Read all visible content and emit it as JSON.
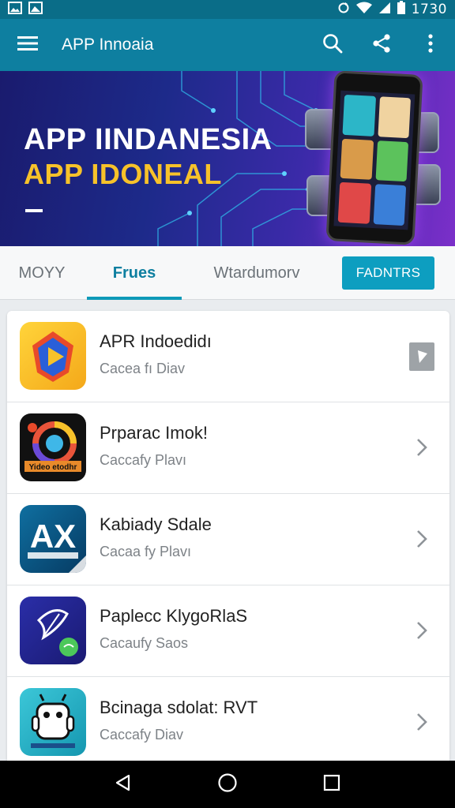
{
  "status_bar": {
    "time": "1730",
    "icons": [
      "image-icon",
      "gallery-icon",
      "sync-icon",
      "wifi-icon",
      "signal-icon",
      "battery-icon"
    ]
  },
  "app_bar": {
    "title": "APP Innoaia",
    "icons": [
      "menu-icon",
      "search-icon",
      "share-icon",
      "more-vert-icon"
    ],
    "background": "#0e7fa0"
  },
  "banner": {
    "title_line1": "APP IINDANESIA",
    "title_line2": "APP IDONEAL",
    "title_line1_color": "#ffffff",
    "title_line2_color": "#f7c22a"
  },
  "tabs": {
    "items": [
      {
        "label": "MOYY",
        "active": false
      },
      {
        "label": "Frues",
        "active": true
      },
      {
        "label": "Wtardumorv",
        "active": false
      }
    ],
    "button_label": "FADNTRS",
    "accent": "#0e9ab8"
  },
  "apps": [
    {
      "name": "APR Indoedidı",
      "subtitle": "Cacea fı Diav",
      "icon": "play-logo-icon",
      "trailing": "play-badge-icon"
    },
    {
      "name": "Prparac Imok!",
      "subtitle": "Caccafy Plavı",
      "icon": "camera-lens-logo-icon",
      "icon_text": "Yideo etodhr",
      "trailing": "chevron-right-icon"
    },
    {
      "name": "Kabiady Sdale",
      "subtitle": "Cacaa fy Plavı",
      "icon": "ax-logo-icon",
      "icon_text": "AX",
      "trailing": "chevron-right-icon"
    },
    {
      "name": "Paplecc KlygoRlaS",
      "subtitle": "Cacaufy Saos",
      "icon": "feather-chat-logo-icon",
      "trailing": "chevron-right-icon"
    },
    {
      "name": "Bcinaga sdolat: RVT",
      "subtitle": "Caccafy Diav",
      "icon": "robot-logo-icon",
      "trailing": "chevron-right-icon"
    }
  ],
  "nav_bar": {
    "icons": [
      "back-icon",
      "home-icon",
      "recents-icon"
    ]
  }
}
